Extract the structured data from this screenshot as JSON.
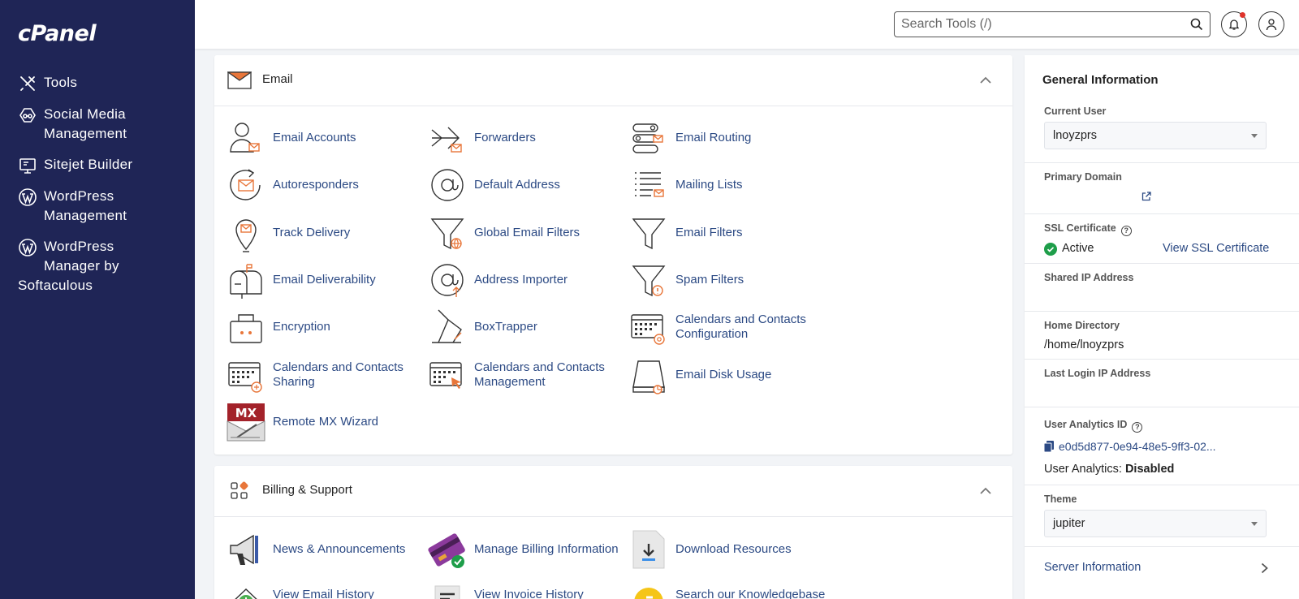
{
  "sidebar": {
    "logo": "cPanel",
    "items": [
      {
        "label": "Tools"
      },
      {
        "label1": "Social Media",
        "label2": "Management"
      },
      {
        "label": "Sitejet Builder"
      },
      {
        "label1": "WordPress",
        "label2": "Management"
      },
      {
        "label1": "WordPress",
        "label2": "Manager by",
        "label3": "Softaculous"
      }
    ]
  },
  "topbar": {
    "search_placeholder": "Search Tools (/)"
  },
  "email_section": {
    "title": "Email",
    "tools": [
      {
        "label": "Email Accounts",
        "icon": "email-accounts-icon"
      },
      {
        "label": "Forwarders",
        "icon": "forwarders-icon"
      },
      {
        "label": "Email Routing",
        "icon": "email-routing-icon"
      },
      {
        "label": "Autoresponders",
        "icon": "autoresponders-icon"
      },
      {
        "label": "Default Address",
        "icon": "at-sign-icon"
      },
      {
        "label": "Mailing Lists",
        "icon": "mailing-lists-icon"
      },
      {
        "label": "Track Delivery",
        "icon": "map-pin-icon"
      },
      {
        "label": "Global Email Filters",
        "icon": "funnel-globe-icon"
      },
      {
        "label": "Email Filters",
        "icon": "funnel-icon"
      },
      {
        "label": "Email Deliverability",
        "icon": "mailbox-icon"
      },
      {
        "label": "Address Importer",
        "icon": "at-import-icon"
      },
      {
        "label": "Spam Filters",
        "icon": "funnel-warning-icon"
      },
      {
        "label": "Encryption",
        "icon": "lock-icon"
      },
      {
        "label": "BoxTrapper",
        "icon": "boxtrapper-icon"
      },
      {
        "label": "Calendars and Contacts Configuration",
        "icon": "calendar-at-icon"
      },
      {
        "label": "Calendars and Contacts Sharing",
        "icon": "calendar-share-icon"
      },
      {
        "label": "Calendars and Contacts Management",
        "icon": "calendar-manage-icon"
      },
      {
        "label": "Email Disk Usage",
        "icon": "disk-usage-icon"
      },
      {
        "label": "Remote MX Wizard",
        "icon": "mx-wizard-icon"
      }
    ]
  },
  "billing_section": {
    "title": "Billing & Support",
    "tools": [
      {
        "label": "News & Announcements",
        "icon": "megaphone-icon"
      },
      {
        "label": "Manage Billing Information",
        "icon": "credit-card-icon"
      },
      {
        "label": "Download Resources",
        "icon": "download-icon"
      },
      {
        "label": "View Email History",
        "icon": "email-history-icon"
      },
      {
        "label": "View Invoice History",
        "icon": "invoice-icon"
      },
      {
        "label": "Search our Knowledgebase",
        "icon": "knowledgebase-icon"
      }
    ]
  },
  "general_info": {
    "title": "General Information",
    "current_user_label": "Current User",
    "current_user": "lnoyzprs",
    "primary_domain_label": "Primary Domain",
    "ssl_label": "SSL Certificate",
    "ssl_status": "Active",
    "ssl_link": "View SSL Certificate",
    "shared_ip_label": "Shared IP Address",
    "home_dir_label": "Home Directory",
    "home_dir": "/home/lnoyzprs",
    "last_login_label": "Last Login IP Address",
    "analytics_id_label": "User Analytics ID",
    "analytics_id": "e0d5d877-0e94-48e5-9ff3-02...",
    "analytics_prefix": "User Analytics:",
    "analytics_status": "Disabled",
    "theme_label": "Theme",
    "theme": "jupiter",
    "server_info": "Server Information"
  },
  "colors": {
    "sidebar_bg": "#1f2556",
    "link": "#2c4a84",
    "accent_orange": "#e8763a",
    "success_green": "#1e9e4a"
  }
}
